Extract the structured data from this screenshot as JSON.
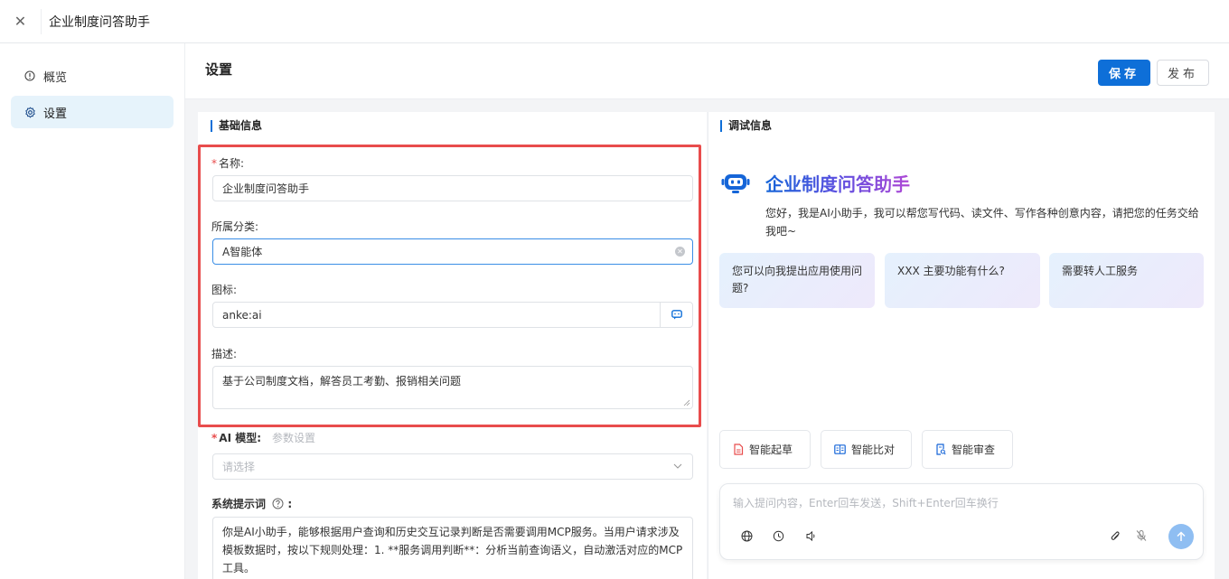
{
  "window": {
    "title": "企业制度问答助手"
  },
  "sidebar": {
    "items": [
      {
        "label": "概览",
        "icon": "info-circle-icon"
      },
      {
        "label": "设置",
        "icon": "gear-icon"
      }
    ]
  },
  "header": {
    "page_title": "设置",
    "save_label": "保存",
    "publish_label": "发布"
  },
  "basic": {
    "section_title": "基础信息",
    "name_label": "名称:",
    "name_value": "企业制度问答助手",
    "category_label": "所属分类:",
    "category_value": "A智能体",
    "icon_label": "图标:",
    "icon_value": "anke:ai",
    "desc_label": "描述:",
    "desc_value": "基于公司制度文档，解答员工考勤、报销相关问题",
    "model_label": "AI 模型:",
    "model_param_link": "参数设置",
    "model_placeholder": "请选择",
    "prompt_label": "系统提示词",
    "prompt_colon": ":",
    "prompt_value": "你是AI小助手，能够根据用户查询和历史交互记录判断是否需要调用MCP服务。当用户请求涉及模板数据时，按以下规则处理：1. **服务调用判断**：分析当前查询语义，自动激活对应的MCP工具。"
  },
  "debug": {
    "section_title": "调试信息",
    "bot_name": "企业制度问答助手",
    "intro": "您好，我是AI小助手，我可以帮您写代码、读文件、写作各种创意内容，请把您的任务交给我吧~",
    "suggestions": [
      "您可以向我提出应用使用问题?",
      "XXX 主要功能有什么?",
      "需要转人工服务"
    ],
    "tools": [
      {
        "label": "智能起草",
        "icon": "document-icon"
      },
      {
        "label": "智能比对",
        "icon": "compare-icon"
      },
      {
        "label": "智能审查",
        "icon": "review-icon"
      }
    ],
    "chat_placeholder": "输入提问内容，Enter回车发送，Shift+Enter回车换行"
  },
  "colors": {
    "primary": "#0e6fd8",
    "highlight_border": "#e84c4c",
    "active_sidebar": "#e6f3fb"
  }
}
